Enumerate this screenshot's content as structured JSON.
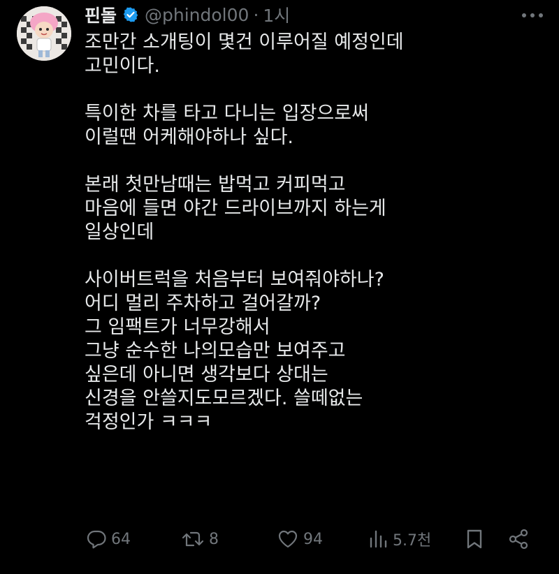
{
  "tweet": {
    "display_name": "핀돌",
    "handle": "@phindol00",
    "separator": "·",
    "time": "1시",
    "lines": [
      "조만간 소개팅이 몇건 이루어질 예정인데",
      "고민이다.",
      "",
      "특이한 차를 타고 다니는 입장으로써",
      "이럴땐 어케해야하나 싶다.",
      "",
      "본래 첫만남때는 밥먹고 커피먹고",
      "마음에 들면 야간 드라이브까지 하는게",
      "일상인데",
      "",
      "사이버트럭을 처음부터 보여줘야하나?",
      "어디 멀리 주차하고 걸어갈까?",
      "그 임팩트가 너무강해서",
      "그냥 순수한 나의모습만 보여주고",
      "싶은데 아니면 생각보다 상대는",
      "신경을 안쓸지도모르겠다. 쓸떼없는",
      "걱정인가 ㅋㅋㅋ"
    ]
  },
  "actions": {
    "reply_count": "64",
    "retweet_count": "8",
    "like_count": "94",
    "views_count": "5.7천"
  },
  "colors": {
    "background": "#000000",
    "text": "#e7e9ea",
    "secondary": "#71767b",
    "verified": "#1d9bf0"
  },
  "icons": {
    "verified": "verified-badge-icon",
    "more": "more-icon",
    "reply": "reply-icon",
    "retweet": "retweet-icon",
    "like": "like-icon",
    "views": "views-icon",
    "bookmark": "bookmark-icon",
    "share": "share-icon"
  }
}
